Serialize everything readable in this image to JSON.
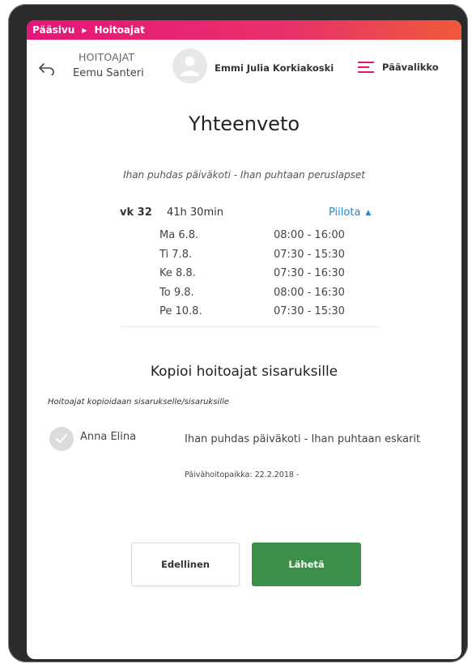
{
  "breadcrumb": {
    "home": "Pääsivu",
    "current": "Hoitoajat"
  },
  "header": {
    "category": "HOITOAJAT",
    "child_name": "Eemu Santeri",
    "user_name": "Emmi Julia Korkiakoski",
    "menu_label": "Päävalikko"
  },
  "summary": {
    "title": "Yhteenveto",
    "unit": "Ihan puhdas päiväkoti - Ihan puhtaan peruslapset",
    "week": {
      "label": "vk 32",
      "total": "41h 30min",
      "toggle_label": "Piilota",
      "days": [
        {
          "day": "Ma 6.8.",
          "time": "08:00 - 16:00"
        },
        {
          "day": "Ti 7.8.",
          "time": "07:30 - 15:30"
        },
        {
          "day": "Ke 8.8.",
          "time": "07:30 - 16:30"
        },
        {
          "day": "To 9.8.",
          "time": "08:00 - 16:30"
        },
        {
          "day": "Pe 10.8.",
          "time": "07:30 - 15:30"
        }
      ]
    }
  },
  "copy": {
    "title": "Kopioi hoitoajat sisaruksille",
    "note": "Hoitoajat kopioidaan sisarukselle/sisaruksille",
    "siblings": [
      {
        "name": "Anna Elina",
        "unit": "Ihan puhdas päiväkoti - Ihan puhtaan eskarit",
        "placement": "Päivähoitopaikka: 22.2.2018 -"
      }
    ]
  },
  "actions": {
    "previous_label": "Edellinen",
    "send_label": "Lähetä"
  },
  "colors": {
    "brand_pink": "#e6157a",
    "accent_blue": "#1e88c8",
    "primary_green": "#3b8f48"
  }
}
